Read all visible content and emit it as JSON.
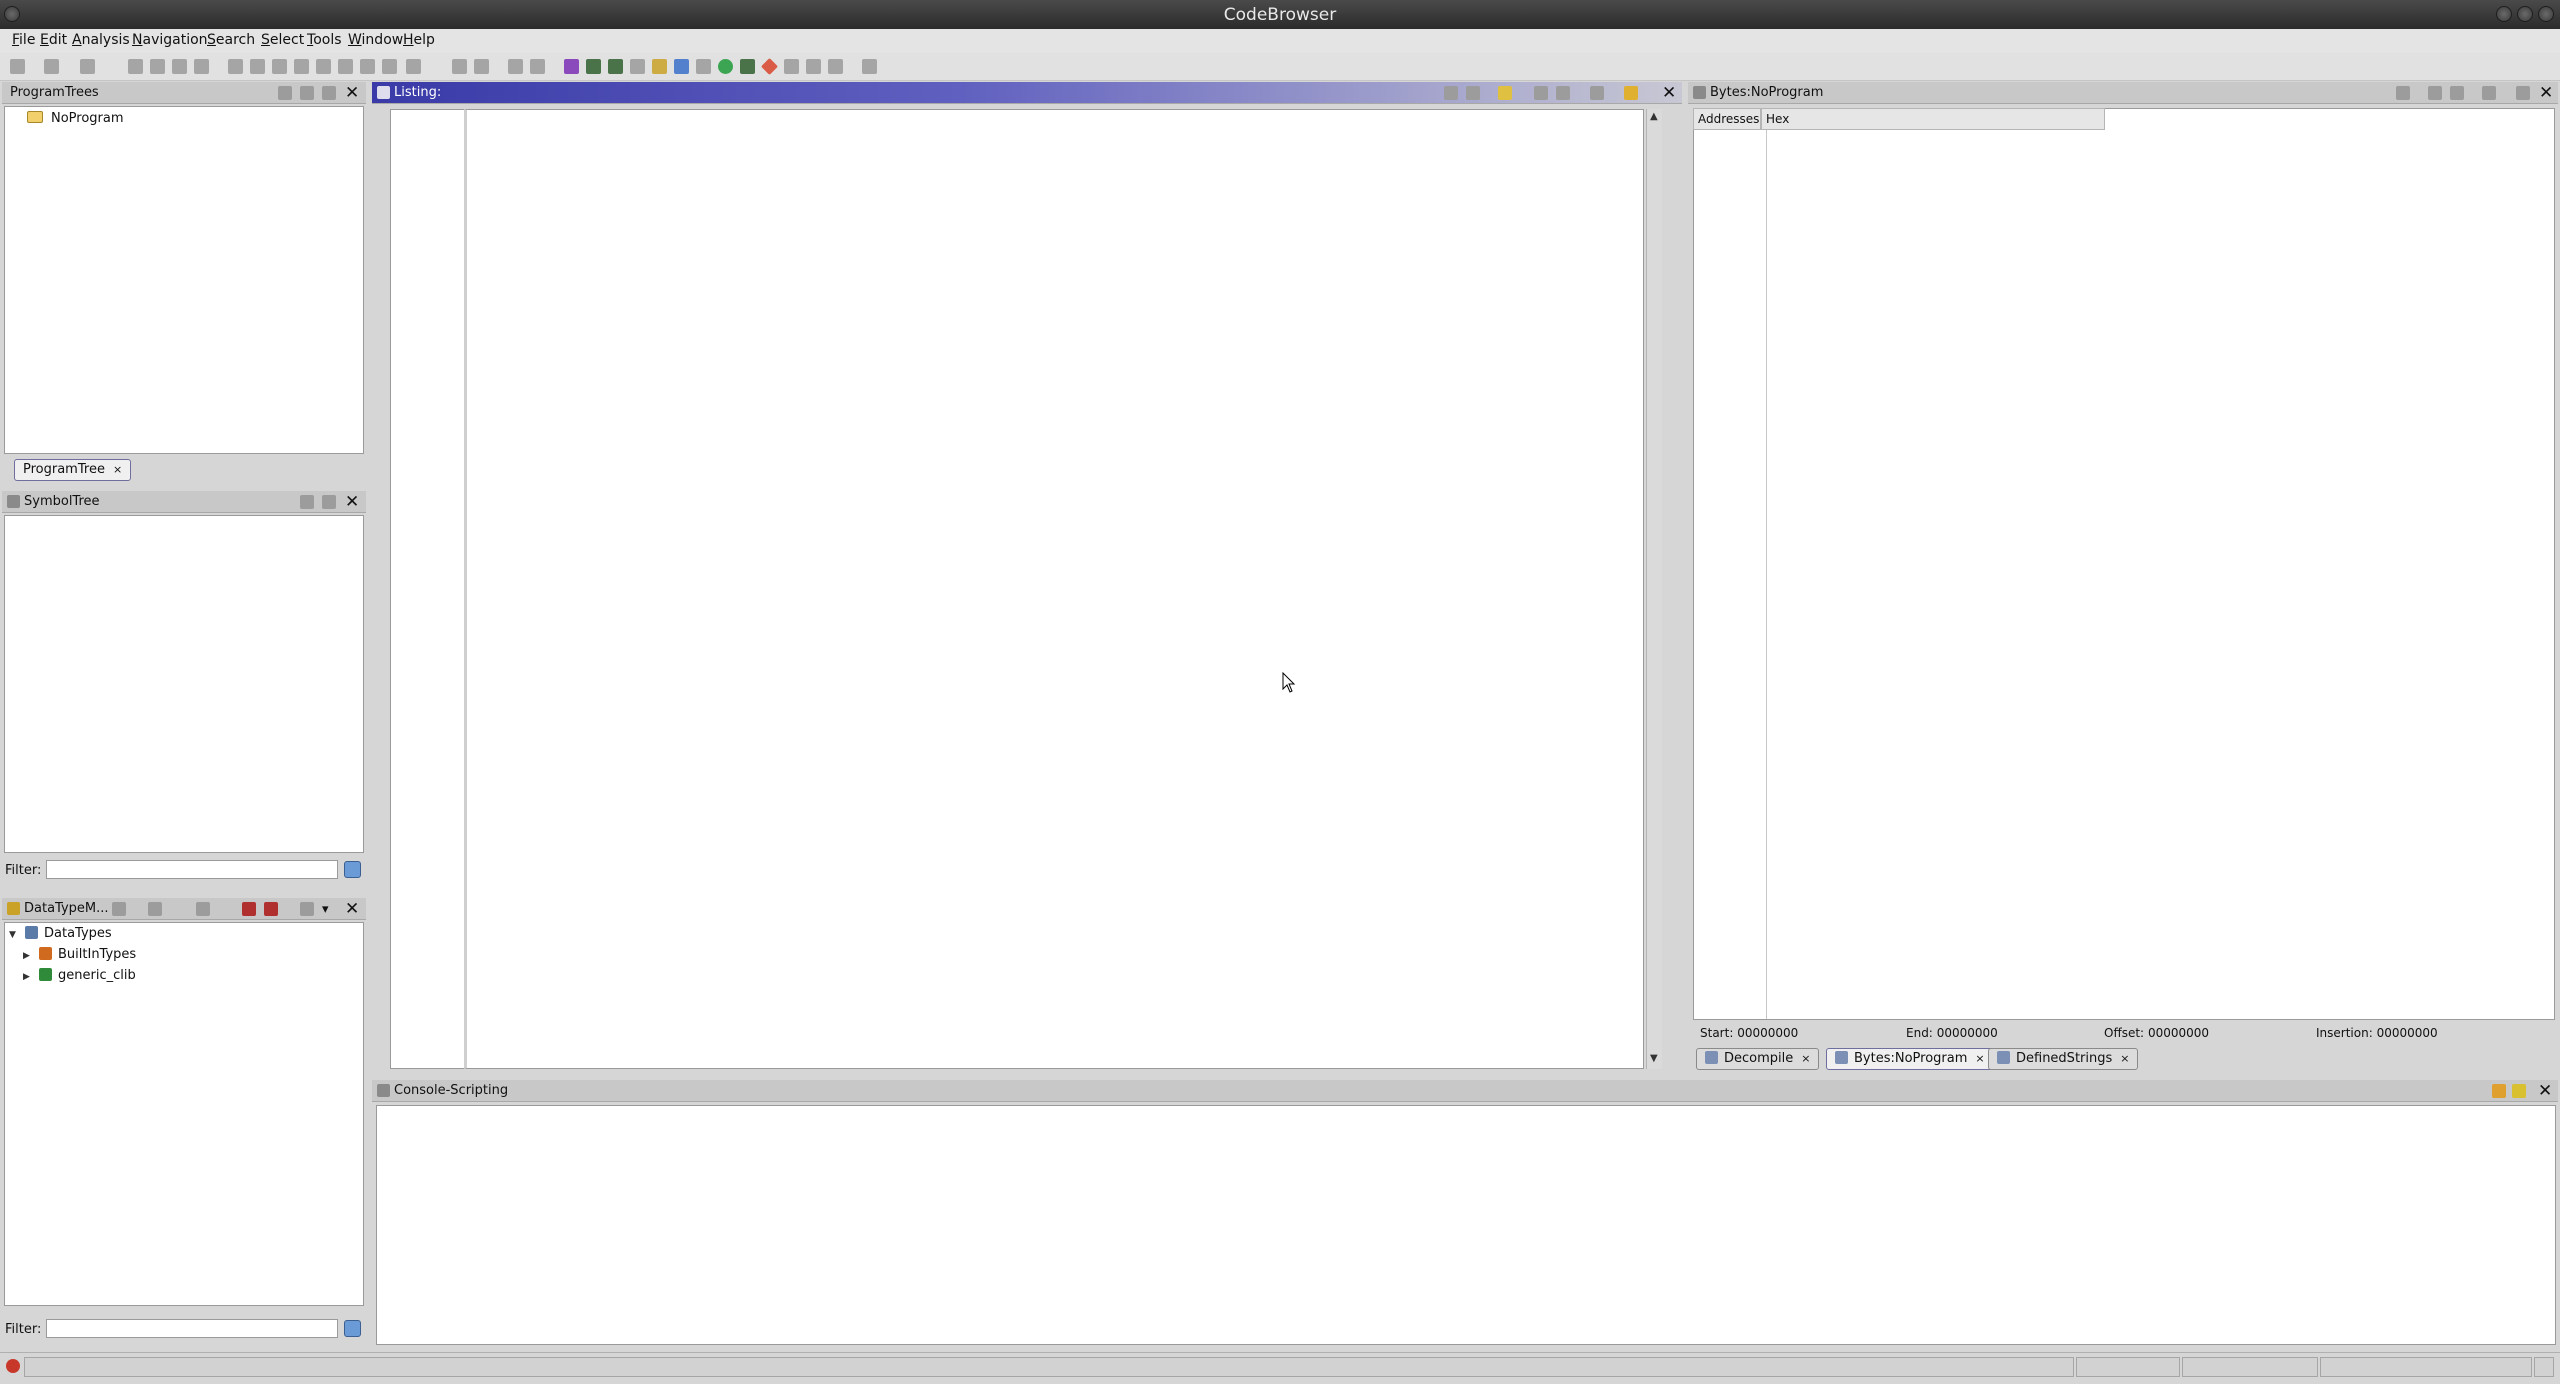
{
  "window": {
    "title": "CodeBrowser"
  },
  "menu": [
    {
      "mnemonic": "F",
      "rest": "ile"
    },
    {
      "mnemonic": "E",
      "rest": "dit"
    },
    {
      "mnemonic": "A",
      "rest": "nalysis"
    },
    {
      "mnemonic": "N",
      "rest": "avigation"
    },
    {
      "mnemonic": "S",
      "rest": "earch"
    },
    {
      "mnemonic": "S",
      "rest": "elect"
    },
    {
      "mnemonic": "T",
      "rest": "ools"
    },
    {
      "mnemonic": "W",
      "rest": "indow"
    },
    {
      "mnemonic": "H",
      "rest": "elp"
    }
  ],
  "program_trees": {
    "title": "ProgramTrees",
    "root": "NoProgram",
    "tab": "ProgramTree",
    "tab_close": "×"
  },
  "symbol_tree": {
    "title": "SymbolTree",
    "filter_label": "Filter:",
    "filter_value": ""
  },
  "data_type_manager": {
    "title": "DataTypeM...",
    "root": "DataTypes",
    "children": [
      "BuiltInTypes",
      "generic_clib"
    ],
    "filter_label": "Filter:",
    "filter_value": ""
  },
  "listing": {
    "title": "Listing:"
  },
  "bytes": {
    "title": "Bytes:NoProgram",
    "columns": [
      "Addresses",
      "Hex"
    ],
    "start_label": "Start:",
    "start": "00000000",
    "end_label": "End:",
    "end": "00000000",
    "offset_label": "Offset:",
    "offset": "00000000",
    "insertion_label": "Insertion:",
    "insertion": "00000000"
  },
  "right_tabs": [
    {
      "label": "Decompile",
      "close": "×"
    },
    {
      "label": "Bytes:NoProgram",
      "close": "×"
    },
    {
      "label": "DefinedStrings",
      "close": "×"
    }
  ],
  "console": {
    "title": "Console-Scripting"
  },
  "icons": {
    "close": "close-icon",
    "folder": "folder-icon"
  }
}
